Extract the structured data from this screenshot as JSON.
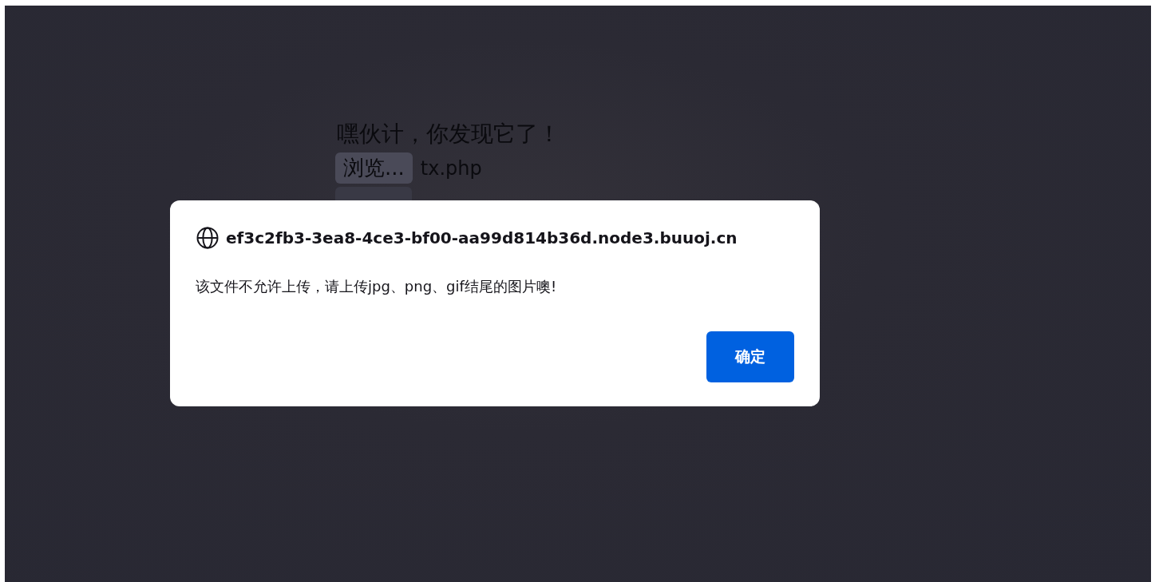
{
  "page": {
    "heading": "嘿伙计，你发现它了！",
    "browse_button": "浏览...",
    "file_name": "tx.php"
  },
  "dialog": {
    "title": "ef3c2fb3-3ea8-4ce3-bf00-aa99d814b36d.node3.buuoj.cn",
    "message": "该文件不允许上传，请上传jpg、png、gif结尾的图片噢!",
    "buttons": [
      "确定"
    ]
  }
}
